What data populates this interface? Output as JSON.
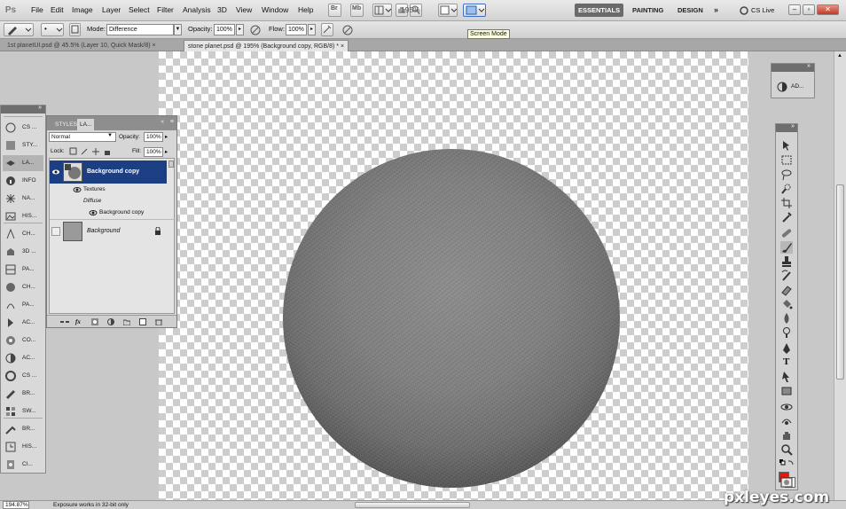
{
  "app": {
    "logo": "Ps"
  },
  "menu": {
    "items": [
      "File",
      "Edit",
      "Image",
      "Layer",
      "Select",
      "Filter",
      "Analysis",
      "3D",
      "View",
      "Window",
      "Help"
    ]
  },
  "titlebar": {
    "zoom": "195%",
    "workspaces": [
      "ESSENTIALS",
      "PAINTING",
      "DESIGN"
    ],
    "more": "»",
    "cslive": "CS Live",
    "tooltip": "Screen Mode"
  },
  "options": {
    "mode_label": "Mode:",
    "mode_value": "Difference",
    "opacity_label": "Opacity:",
    "opacity_value": "100%",
    "flow_label": "Flow:",
    "flow_value": "100%"
  },
  "tabs": [
    {
      "label": "1st planetUI.psd @ 45.5% (Layer 10, Quick Mask/8)",
      "close": "×"
    },
    {
      "label": "stone planet.psd @ 195% (Background copy, RGB/8) *",
      "close": "×"
    }
  ],
  "left_dock": {
    "items": [
      "CS ...",
      "STY...",
      "LA...",
      "INFO",
      "NA...",
      "HIS...",
      "CH...",
      "3D ...",
      "PA...",
      "CH...",
      "PA...",
      "AC...",
      "CO...",
      "AC...",
      "CS ...",
      "BR...",
      "SW...",
      "BR...",
      "HIS...",
      "CI..."
    ]
  },
  "layers_panel": {
    "tabs": [
      "STYLES",
      "LA..."
    ],
    "blend_mode": "Normal",
    "opacity_label": "Opacity:",
    "opacity_value": "100%",
    "lock_label": "Lock:",
    "fill_label": "Fill:",
    "fill_value": "100%",
    "layers": [
      {
        "name": "Background copy",
        "selected": true
      },
      {
        "name": "Textures"
      },
      {
        "name": "Diffuse"
      },
      {
        "name": "Background copy"
      },
      {
        "name": "Background"
      }
    ]
  },
  "right_top_panel": {
    "label": "AD..."
  },
  "status": {
    "zoom": "194.87%",
    "message": "Exposure works in 32-bit only"
  },
  "watermark": "pxleyes.com",
  "colors": {
    "foreground": "#dd1a12",
    "background": "#ffffff",
    "selection": "#1c3f83",
    "accent": "#6a6a6a"
  }
}
